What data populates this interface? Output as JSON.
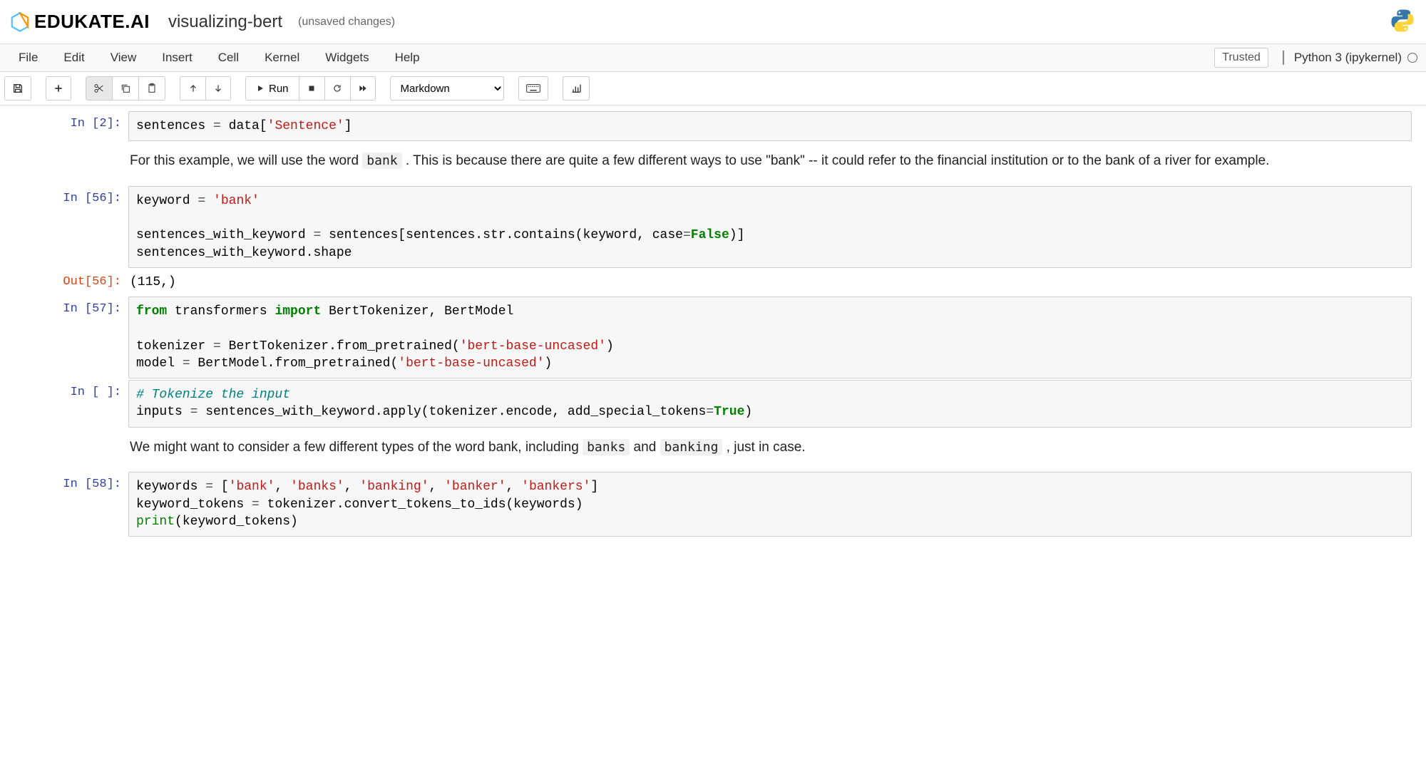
{
  "header": {
    "brand": "EDUKATE.AI",
    "notebook_name": "visualizing-bert",
    "save_status": "(unsaved changes)"
  },
  "menu": {
    "items": [
      "File",
      "Edit",
      "View",
      "Insert",
      "Cell",
      "Kernel",
      "Widgets",
      "Help"
    ],
    "trusted": "Trusted",
    "kernel": "Python 3 (ipykernel)"
  },
  "toolbar": {
    "run_label": "Run",
    "celltype_selected": "Markdown"
  },
  "cells": {
    "c0": {
      "in_prompt": "In [2]:",
      "line1_a": "sentences ",
      "line1_b": " data[",
      "line1_c": "'Sentence'",
      "line1_d": "]"
    },
    "md1": {
      "t1": "For this example, we will use the word ",
      "code": "bank",
      "t2": " . This is because there are quite a few different ways to use \"bank\" -- it could refer to the financial institution or to the bank of a river for example."
    },
    "c1": {
      "in_prompt": "In [56]:",
      "l1a": "keyword ",
      "l1b": " ",
      "l1c": "'bank'",
      "l3a": "sentences_with_keyword ",
      "l3b": " sentences[sentences.str.contains(keyword, case",
      "l3c": "False",
      "l3d": ")]",
      "l4": "sentences_with_keyword.shape",
      "out_prompt": "Out[56]:",
      "out_val": "(115,)"
    },
    "c2": {
      "in_prompt": "In [57]:",
      "l1a": "from",
      "l1b": " transformers ",
      "l1c": "import",
      "l1d": " BertTokenizer, BertModel",
      "l3a": "tokenizer ",
      "l3b": " BertTokenizer.from_pretrained(",
      "l3c": "'bert-base-uncased'",
      "l3d": ")",
      "l4a": "model ",
      "l4b": " BertModel.from_pretrained(",
      "l4c": "'bert-base-uncased'",
      "l4d": ")"
    },
    "c3": {
      "in_prompt": "In [ ]:",
      "l1": "# Tokenize the input",
      "l2a": "inputs ",
      "l2b": " sentences_with_keyword.apply(tokenizer.encode, add_special_tokens",
      "l2c": "True",
      "l2d": ")"
    },
    "md2": {
      "t1": "We might want to consider a few different types of the word bank, including ",
      "code1": "banks",
      "t2": " and ",
      "code2": "banking",
      "t3": " , just in case."
    },
    "c4": {
      "in_prompt": "In [58]:",
      "l1a": "keywords ",
      "l1b": " [",
      "l1c": "'bank'",
      "l1d": ", ",
      "l1e": "'banks'",
      "l1f": ", ",
      "l1g": "'banking'",
      "l1h": ", ",
      "l1i": "'banker'",
      "l1j": ", ",
      "l1k": "'bankers'",
      "l1l": "]",
      "l2a": "keyword_tokens ",
      "l2b": " tokenizer.convert_tokens_to_ids(keywords)",
      "l3a": "print",
      "l3b": "(keyword_tokens)"
    }
  }
}
